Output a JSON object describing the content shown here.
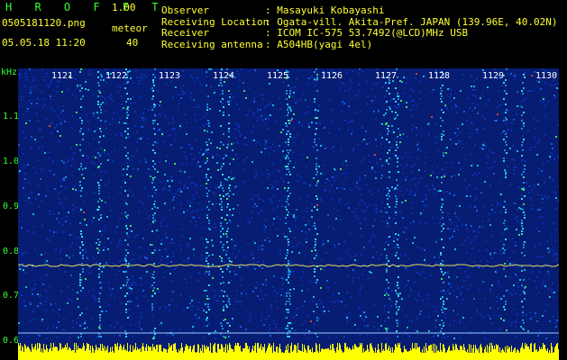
{
  "header": {
    "brand": "H R O F F T",
    "version": "1.00",
    "filename": "0505181120.png",
    "meteor_label": "meteor",
    "datetime": "05.05.18 11:20",
    "meteor_count": "40"
  },
  "info": [
    {
      "label": "Observer",
      "value": ": Masayuki Kobayashi"
    },
    {
      "label": "Receiving Location",
      "value": ": Ogata-vill. Akita-Pref. JAPAN (139.96E, 40.02N)"
    },
    {
      "label": "Receiver",
      "value": ": ICOM IC-575 53.7492(@LCD)MHz USB"
    },
    {
      "label": "Receiving antenna",
      "value": ": A504HB(yagi 4el)"
    }
  ],
  "axis": {
    "unit": "kHz",
    "ticks": [
      "1.1",
      "1.0",
      "0.9",
      "0.8",
      "0.7",
      "0.6"
    ]
  },
  "minutes": [
    "1121",
    "1122",
    "1123",
    "1124",
    "1125",
    "1126",
    "1127",
    "1128",
    "1129",
    "1130"
  ],
  "colors": {
    "text_yellow": "#ffff33",
    "text_green": "#33ff33",
    "plot_bg": "#061a6a",
    "trace": "#ffff00"
  }
}
